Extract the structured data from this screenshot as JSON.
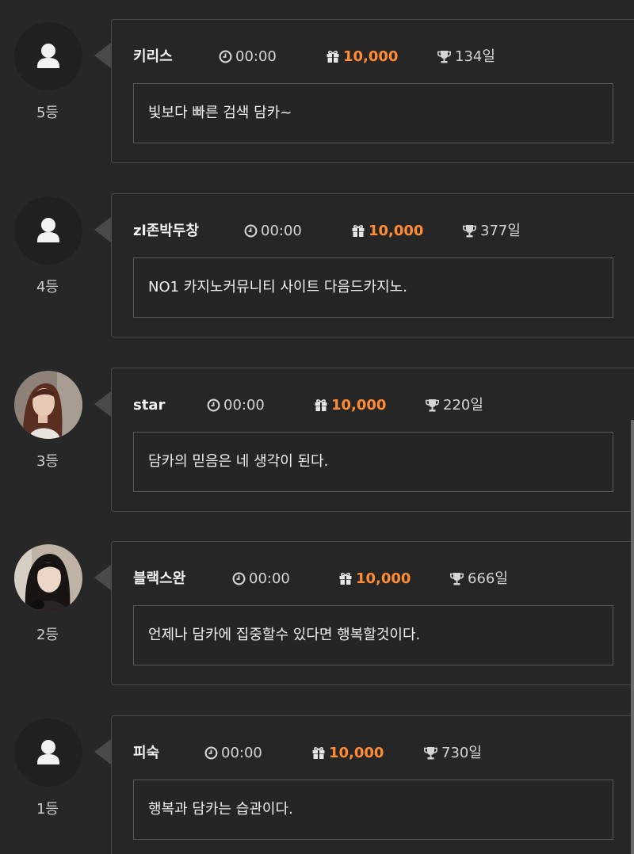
{
  "colors": {
    "background": "#272727",
    "card_border": "#4a4a4a",
    "points": "#ff8c33",
    "text": "#ececec"
  },
  "icons": {
    "time": "clock-icon",
    "points": "gift-icon",
    "days": "trophy-icon",
    "default_avatar": "user-silhouette-icon"
  },
  "entries": [
    {
      "rank": "5등",
      "name": "키리스",
      "time": "00:00",
      "points": "10,000",
      "days": "134일",
      "message": "빛보다 빠른 검색 담카~",
      "avatar": "default"
    },
    {
      "rank": "4등",
      "name": "zl존박두창",
      "time": "00:00",
      "points": "10,000",
      "days": "377일",
      "message": "NO1 카지노커뮤니티 사이트 다음드카지노.",
      "avatar": "default"
    },
    {
      "rank": "3등",
      "name": "star",
      "time": "00:00",
      "points": "10,000",
      "days": "220일",
      "message": "담카의 믿음은 네 생각이 된다.",
      "avatar": "photo"
    },
    {
      "rank": "2등",
      "name": "블랙스완",
      "time": "00:00",
      "points": "10,000",
      "days": "666일",
      "message": "언제나 담카에 집중할수 있다면 행복할것이다.",
      "avatar": "photo"
    },
    {
      "rank": "1등",
      "name": "피숙",
      "time": "00:00",
      "points": "10,000",
      "days": "730일",
      "message": "행복과 담카는 습관이다.",
      "avatar": "default"
    }
  ]
}
